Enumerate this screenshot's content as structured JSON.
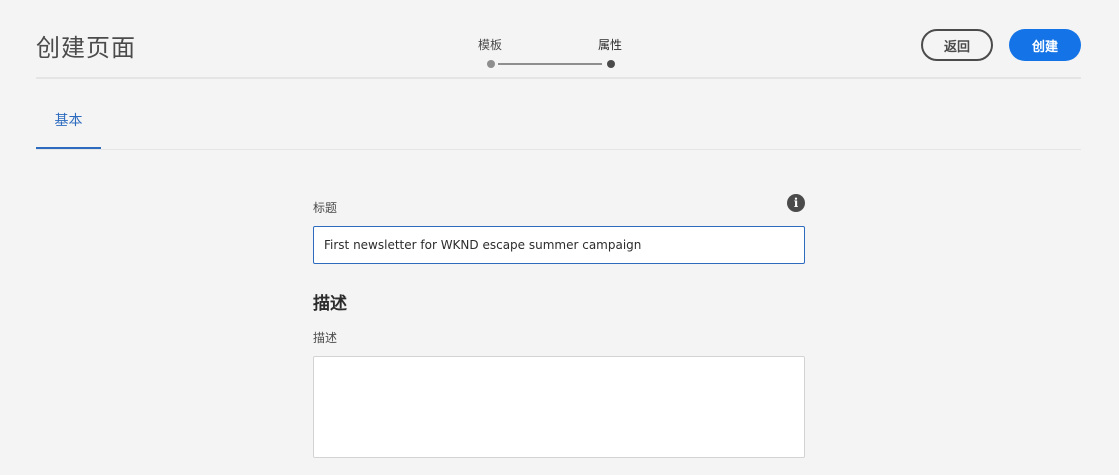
{
  "header": {
    "title": "创建页面",
    "steps": [
      {
        "label": "模板",
        "state": "completed"
      },
      {
        "label": "属性",
        "state": "current"
      }
    ],
    "back_label": "返回",
    "create_label": "创建"
  },
  "tabs": [
    {
      "label": "基本",
      "selected": true
    }
  ],
  "form": {
    "title_label": "标题",
    "title_value": "First newsletter for WKND escape summer campaign",
    "info_icon": "info-icon",
    "section_heading": "描述",
    "description_label": "描述",
    "description_value": ""
  },
  "colors": {
    "accent": "#1473e6",
    "tab_active": "#2d6bbf",
    "background": "#f4f4f4"
  }
}
